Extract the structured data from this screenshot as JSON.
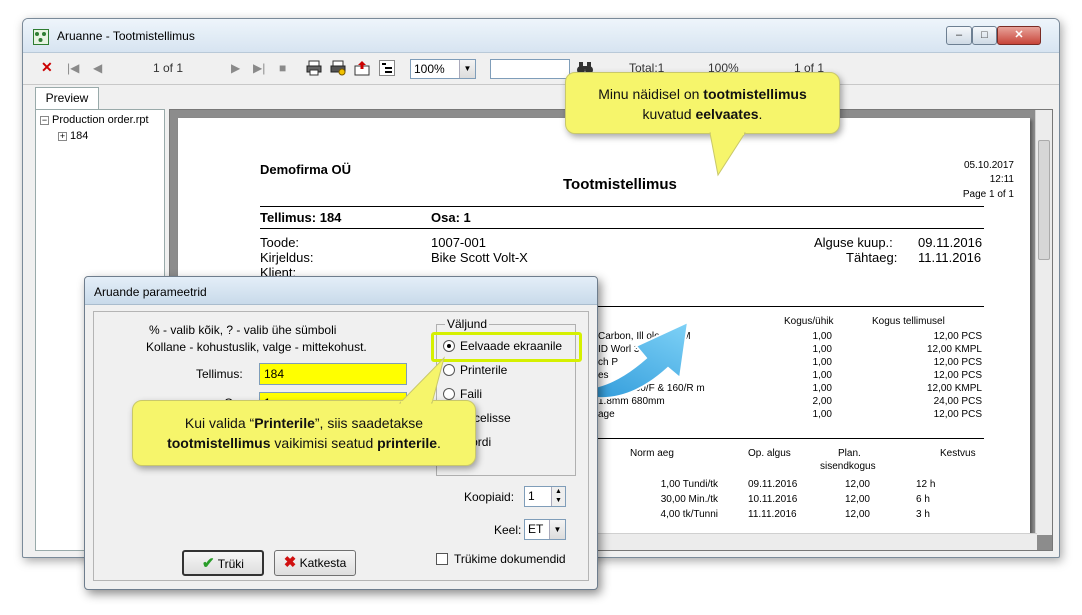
{
  "window": {
    "title": "Aruanne - Tootmistellimus",
    "min_label": "–",
    "max_label": "□",
    "close_label": "✕"
  },
  "toolbar": {
    "page_indicator": "1 of 1",
    "zoom_value": "100%",
    "status_total": "Total:1",
    "status_zoom": "100%",
    "status_page": "1 of 1"
  },
  "tabs": {
    "preview": "Preview"
  },
  "tree": {
    "root": "Production order.rpt",
    "child": "184"
  },
  "report": {
    "company": "Demofirma OÜ",
    "title": "Tootmistellimus",
    "date": "05.10.2017",
    "time": "12:11",
    "page": "Page 1 of 1",
    "order_label": "Tellimus: 184",
    "part_label": "Osa: 1",
    "product_label": "Toode:",
    "product_value": "1007-001",
    "desc_label": "Kirjeldus:",
    "desc_value": "Bike Scott Volt-X",
    "client_label": "Klient:",
    "start_label": "Alguse kuup.:",
    "start_value": "09.11.2016",
    "due_label": "Tähtaeg:",
    "due_value": "11.11.2016",
    "col_qty_unit": "Kogus/ühik",
    "col_qty_order": "Kogus tellimusel",
    "materials": [
      {
        "desc": "Carbon, Ill   ology, DM",
        "qty": "1,00",
        "total": "12,00 PCS"
      },
      {
        "desc": "ID Worl       3 Air, DNA",
        "qty": "1,00",
        "total": "12,00 KMPL"
      },
      {
        "desc": "ch P",
        "qty": "1,00",
        "total": "12,00 PCS"
      },
      {
        "desc": "es",
        "qty": "1,00",
        "total": "12,00 PCS"
      },
      {
        "desc": "arbon, 180/F & 160/R m",
        "qty": "1,00",
        "total": "12,00 KMPL"
      },
      {
        "desc": "1.8mm 680mm",
        "qty": "2,00",
        "total": "24,00 PCS"
      },
      {
        "desc": "age",
        "qty": "1,00",
        "total": "12,00 PCS"
      }
    ],
    "op_cols": {
      "norm": "Norm aeg",
      "start": "Op. algus",
      "plan": "Plan.",
      "plan2": "sisendkogus",
      "duration": "Kestvus"
    },
    "operations": [
      {
        "norm": "1,00 Tundi/tk",
        "start": "09.11.2016",
        "plan": "12,00",
        "duration": "12 h"
      },
      {
        "norm": "30,00 Min./tk",
        "start": "10.11.2016",
        "plan": "12,00",
        "duration": "6 h"
      },
      {
        "norm": "4,00 tk/Tunni",
        "start": "11.11.2016",
        "plan": "12,00",
        "duration": "3 h"
      }
    ]
  },
  "dialog": {
    "title": "Aruande parameetrid",
    "hint1": "% - valib kõik, ? - valib ühe sümboli",
    "hint2": "Kollane - kohustuslik, valge - mittekohust.",
    "order_label": "Tellimus:",
    "order_value": "184",
    "part_label": "Osa:",
    "part_value": "1",
    "output_legend": "Väljund",
    "opt_screen": "Eelvaade ekraanile",
    "opt_printer": "Printerile",
    "opt_file": "Faili",
    "opt_excel": "Excelisse",
    "opt_word": "Wordi",
    "copies_label": "Koopiaid:",
    "copies_value": "1",
    "lang_label": "Keel:",
    "lang_value": "ET",
    "print_docs_label": "Trükime dokumendid",
    "print_button": "Trüki",
    "cancel_button": "Katkesta"
  },
  "callout_top": {
    "pre": "Minu näidisel on ",
    "b1": "tootmistellimus",
    "mid": "kuvatud ",
    "b2": "eelvaates",
    "end": "."
  },
  "callout_bottom": {
    "pre": "Kui valida “",
    "b1": "Printerile",
    "mid1": "”, siis saadetakse",
    "b2": "tootmistellimus",
    "mid2": " vaikimisi seatud ",
    "b3": "printerile",
    "end": "."
  },
  "colors": {
    "required_field": "#ffff00",
    "callout": "#f6f56b",
    "highlight": "#d5f000",
    "arrow": "#2ea3e0"
  }
}
